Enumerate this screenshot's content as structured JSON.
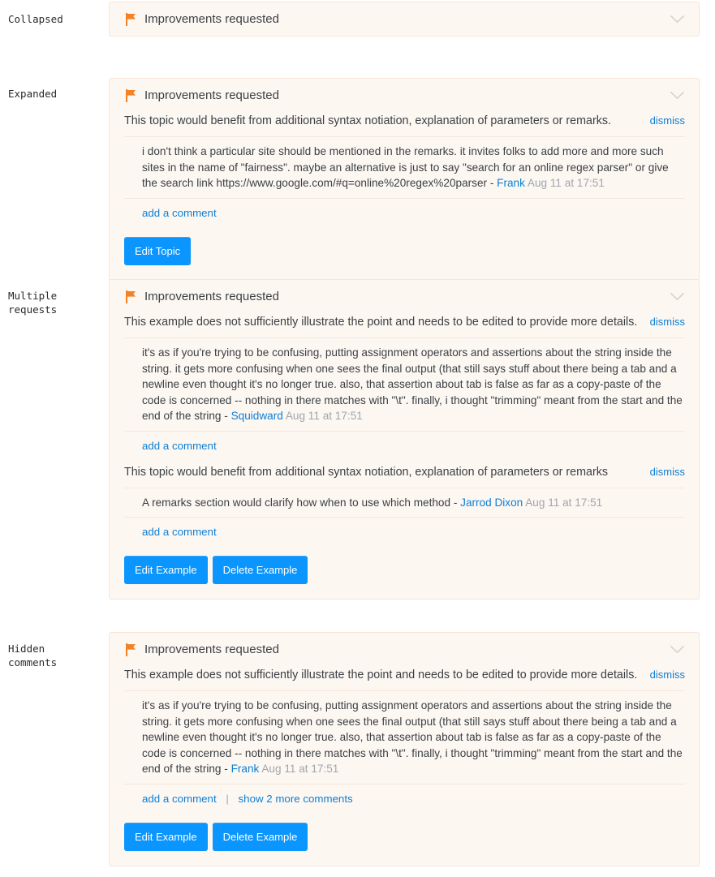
{
  "labels": {
    "collapsed": "Collapsed",
    "expanded": "Expanded",
    "multiple": "Multiple\nrequests",
    "hidden": "Hidden\ncomments"
  },
  "common": {
    "notice_title": "Improvements requested",
    "flag_icon": "flag-icon",
    "chevron_icon": "chevron-down-icon",
    "dismiss_label": "dismiss",
    "add_comment_label": "add a comment",
    "separator": "|"
  },
  "colors": {
    "panel_background": "#fdf7f2",
    "panel_border": "#f7e4d7",
    "flag_orange": "#f48225",
    "link_blue": "#0c7fd4",
    "button_blue": "#0a95ff",
    "body_text": "#3b4045",
    "muted_text": "#9fa6ad"
  },
  "panels": {
    "collapsed": {
      "title": "Improvements requested"
    },
    "expanded": {
      "title": "Improvements requested",
      "requests": [
        {
          "text": "This topic would benefit from additional syntax notiation, explanation of parameters or remarks.",
          "dismiss": "dismiss",
          "comments": [
            {
              "body": "i don't think a particular site should be mentioned in the remarks. it invites folks to add more and more such sites in the name of \"fairness\". maybe an alternative is just to say \"search for an online regex parser\" or give the search link https://www.google.com/#q=online%20regex%20parser - ",
              "user": "Frank",
              "when": "Aug 11 at 17:51"
            }
          ],
          "add_comment": "add a comment"
        }
      ],
      "buttons": [
        "Edit Topic"
      ]
    },
    "multiple": {
      "title": "Improvements requested",
      "requests": [
        {
          "text": "This example does not sufficiently illustrate the point and needs to be edited to provide more details.",
          "dismiss": "dismiss",
          "comments": [
            {
              "body": "it's as if you're trying to be confusing, putting assignment operators and assertions about the string inside the string. it gets more confusing when one sees the final output (that still says stuff about there being a tab and a newline even thought it's no longer true. also, that assertion about tab is false as far as a copy-paste of the code is concerned -- nothing in there matches with \"\\t\". finally, i thought \"trimming\" meant from the start and the end of the string - ",
              "user": "Squidward",
              "when": "Aug 11 at 17:51"
            }
          ],
          "add_comment": "add a comment"
        },
        {
          "text": "This topic would benefit from additional syntax notiation, explanation of parameters or remarks",
          "dismiss": "dismiss",
          "comments": [
            {
              "body": "A remarks section would clarify how when to use which method - ",
              "user": "Jarrod Dixon",
              "when": "Aug 11 at 17:51"
            }
          ],
          "add_comment": "add a comment"
        }
      ],
      "buttons": [
        "Edit Example",
        "Delete Example"
      ]
    },
    "hidden": {
      "title": "Improvements requested",
      "requests": [
        {
          "text": "This example does not sufficiently illustrate the point and needs to be edited to provide more details.",
          "dismiss": "dismiss",
          "comments": [
            {
              "body": "it's as if you're trying to be confusing, putting assignment operators and assertions about the string inside the string. it gets more confusing when one sees the final output (that still says stuff about there being a tab and a newline even thought it's no longer true. also, that assertion about tab is false as far as a copy-paste of the code is concerned -- nothing in there matches with \"\\t\". finally, i thought \"trimming\" meant from the start and the end of the string - ",
              "user": "Frank",
              "when": "Aug 11 at 17:51"
            }
          ],
          "add_comment": "add a comment",
          "show_more": "show 2 more comments"
        }
      ],
      "buttons": [
        "Edit Example",
        "Delete Example"
      ]
    }
  }
}
